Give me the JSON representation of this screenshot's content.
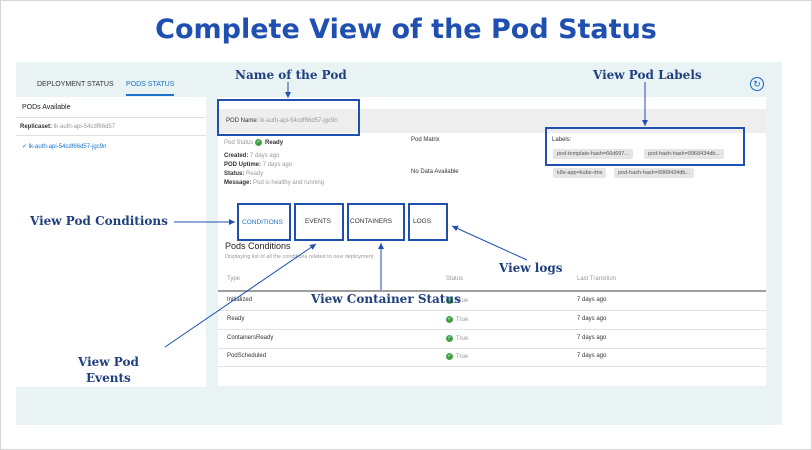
{
  "title": "Complete View of the Pod Status",
  "tabs": [
    {
      "label": "DEPLOYMENT STATUS"
    },
    {
      "label": "PODS STATUS"
    }
  ],
  "sidebar": {
    "header": "PODs Available",
    "replicaset_label": "Replicaset:",
    "replicaset_value": "lk-auth-api-54cdf66d57",
    "selected_pod": "lk-auth-api-54cdf66d57-jgc9n"
  },
  "pod": {
    "name_label": "POD Name:",
    "name_value": "lk-auth-api-54cdf66d57-jgc9n",
    "status_label": "Pod Status",
    "status_value": "Ready",
    "created_label": "Created:",
    "created_value": "7 days ago",
    "uptime_label": "POD Uptime:",
    "uptime_value": "7 days ago",
    "status2_label": "Status:",
    "status2_value": "Ready",
    "message_label": "Message:",
    "message_value": "Pod is healthy and running",
    "matrix_label": "Pod Matrix",
    "no_data": "No Data Available",
    "labels_title": "Labels:",
    "labels": [
      "pod-template-hash=66d697...",
      "pod-hash-hash=9968434db...",
      "k8s-app=kube-dns",
      "pod-hash-hash=9968434db..."
    ]
  },
  "subtabs": [
    {
      "label": "CONDITIONS"
    },
    {
      "label": "EVENTS"
    },
    {
      "label": "CONTAINERS"
    },
    {
      "label": "LOGS"
    }
  ],
  "conditions": {
    "title": "Pods Conditions",
    "subtitle": "Displaying list of all the conditions related to new deployment",
    "columns": [
      "Type",
      "Status",
      "Last Transition"
    ],
    "rows": [
      {
        "type": "Initialized",
        "status": "True",
        "last": "7 days ago"
      },
      {
        "type": "Ready",
        "status": "True",
        "last": "7 days ago"
      },
      {
        "type": "ContainersReady",
        "status": "True",
        "last": "7 days ago"
      },
      {
        "type": "PodScheduled",
        "status": "True",
        "last": "7 days ago"
      }
    ]
  },
  "annotations": {
    "name_of_pod": "Name of the Pod",
    "view_pod_labels": "View Pod Labels",
    "view_pod_conditions": "View Pod Conditions",
    "view_logs": "View logs",
    "view_container_status": "View Container Status",
    "view_pod_events_1": "View Pod",
    "view_pod_events_2": "Events"
  },
  "colors": {
    "accent": "#1f4fb0",
    "link": "#1a73c8",
    "success": "#43a047"
  }
}
